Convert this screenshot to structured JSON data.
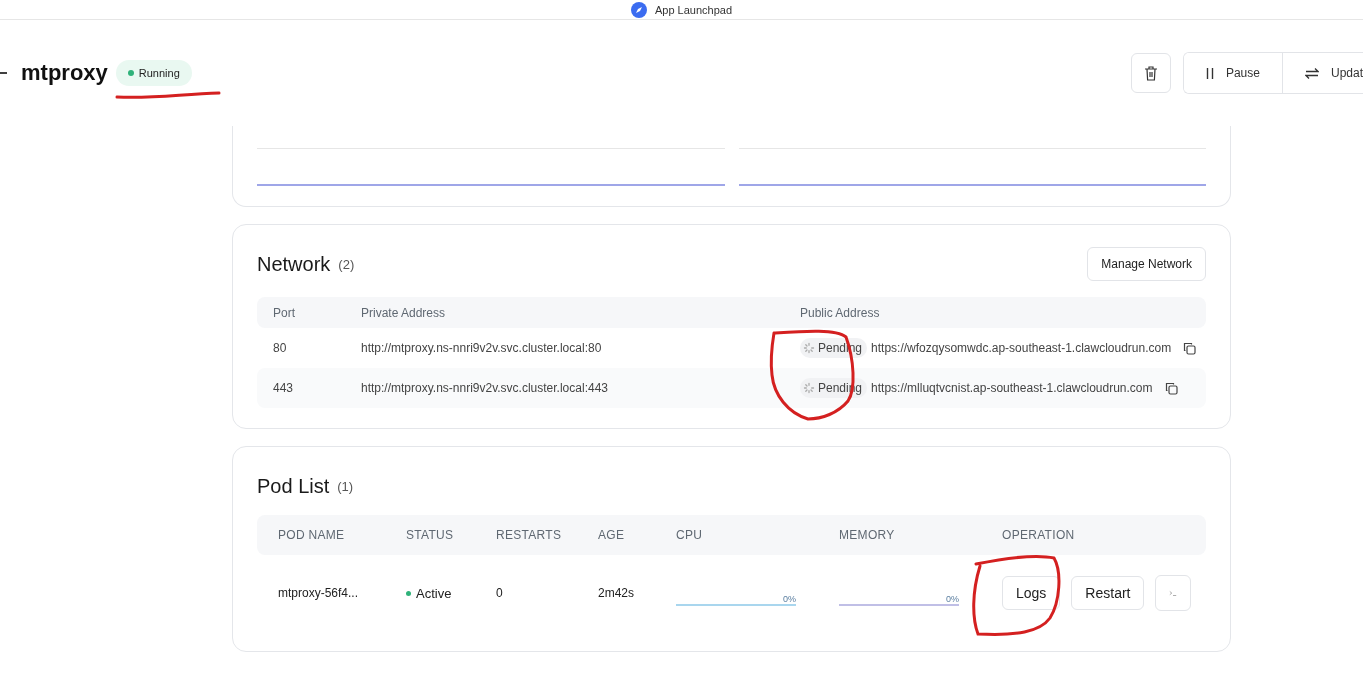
{
  "app_bar": {
    "title": "App Launchpad"
  },
  "header": {
    "title": "mtproxy",
    "status": "Running",
    "buttons": [
      {
        "label": "Pause",
        "kind": "pause"
      },
      {
        "label": "Updat",
        "kind": "update"
      }
    ]
  },
  "network": {
    "title": "Network",
    "count": "(2)",
    "manage_button": "Manage Network",
    "table": {
      "columns": [
        "Port",
        "Private Address",
        "Public Address"
      ],
      "rows": [
        {
          "port": "80",
          "private_address": "http://mtproxy.ns-nnri9v2v.svc.cluster.local:80",
          "public_status": "Pending",
          "public_address": "https://wfozqysomwdc.ap-southeast-1.clawcloudrun.com"
        },
        {
          "port": "443",
          "private_address": "http://mtproxy.ns-nnri9v2v.svc.cluster.local:443",
          "public_status": "Pending",
          "public_address": "https://mlluqtvcnist.ap-southeast-1.clawcloudrun.com"
        }
      ]
    }
  },
  "pods": {
    "title": "Pod List",
    "count": "(1)",
    "table": {
      "columns": [
        "POD NAME",
        "STATUS",
        "RESTARTS",
        "AGE",
        "CPU",
        "MEMORY",
        "OPERATION"
      ],
      "rows": [
        {
          "pod_name": "mtproxy-56f4...",
          "status": "Active",
          "restarts": "0",
          "age": "2m42s",
          "cpu": "0%",
          "memory": "0%",
          "actions": [
            "Logs",
            "Restart"
          ]
        }
      ]
    }
  }
}
